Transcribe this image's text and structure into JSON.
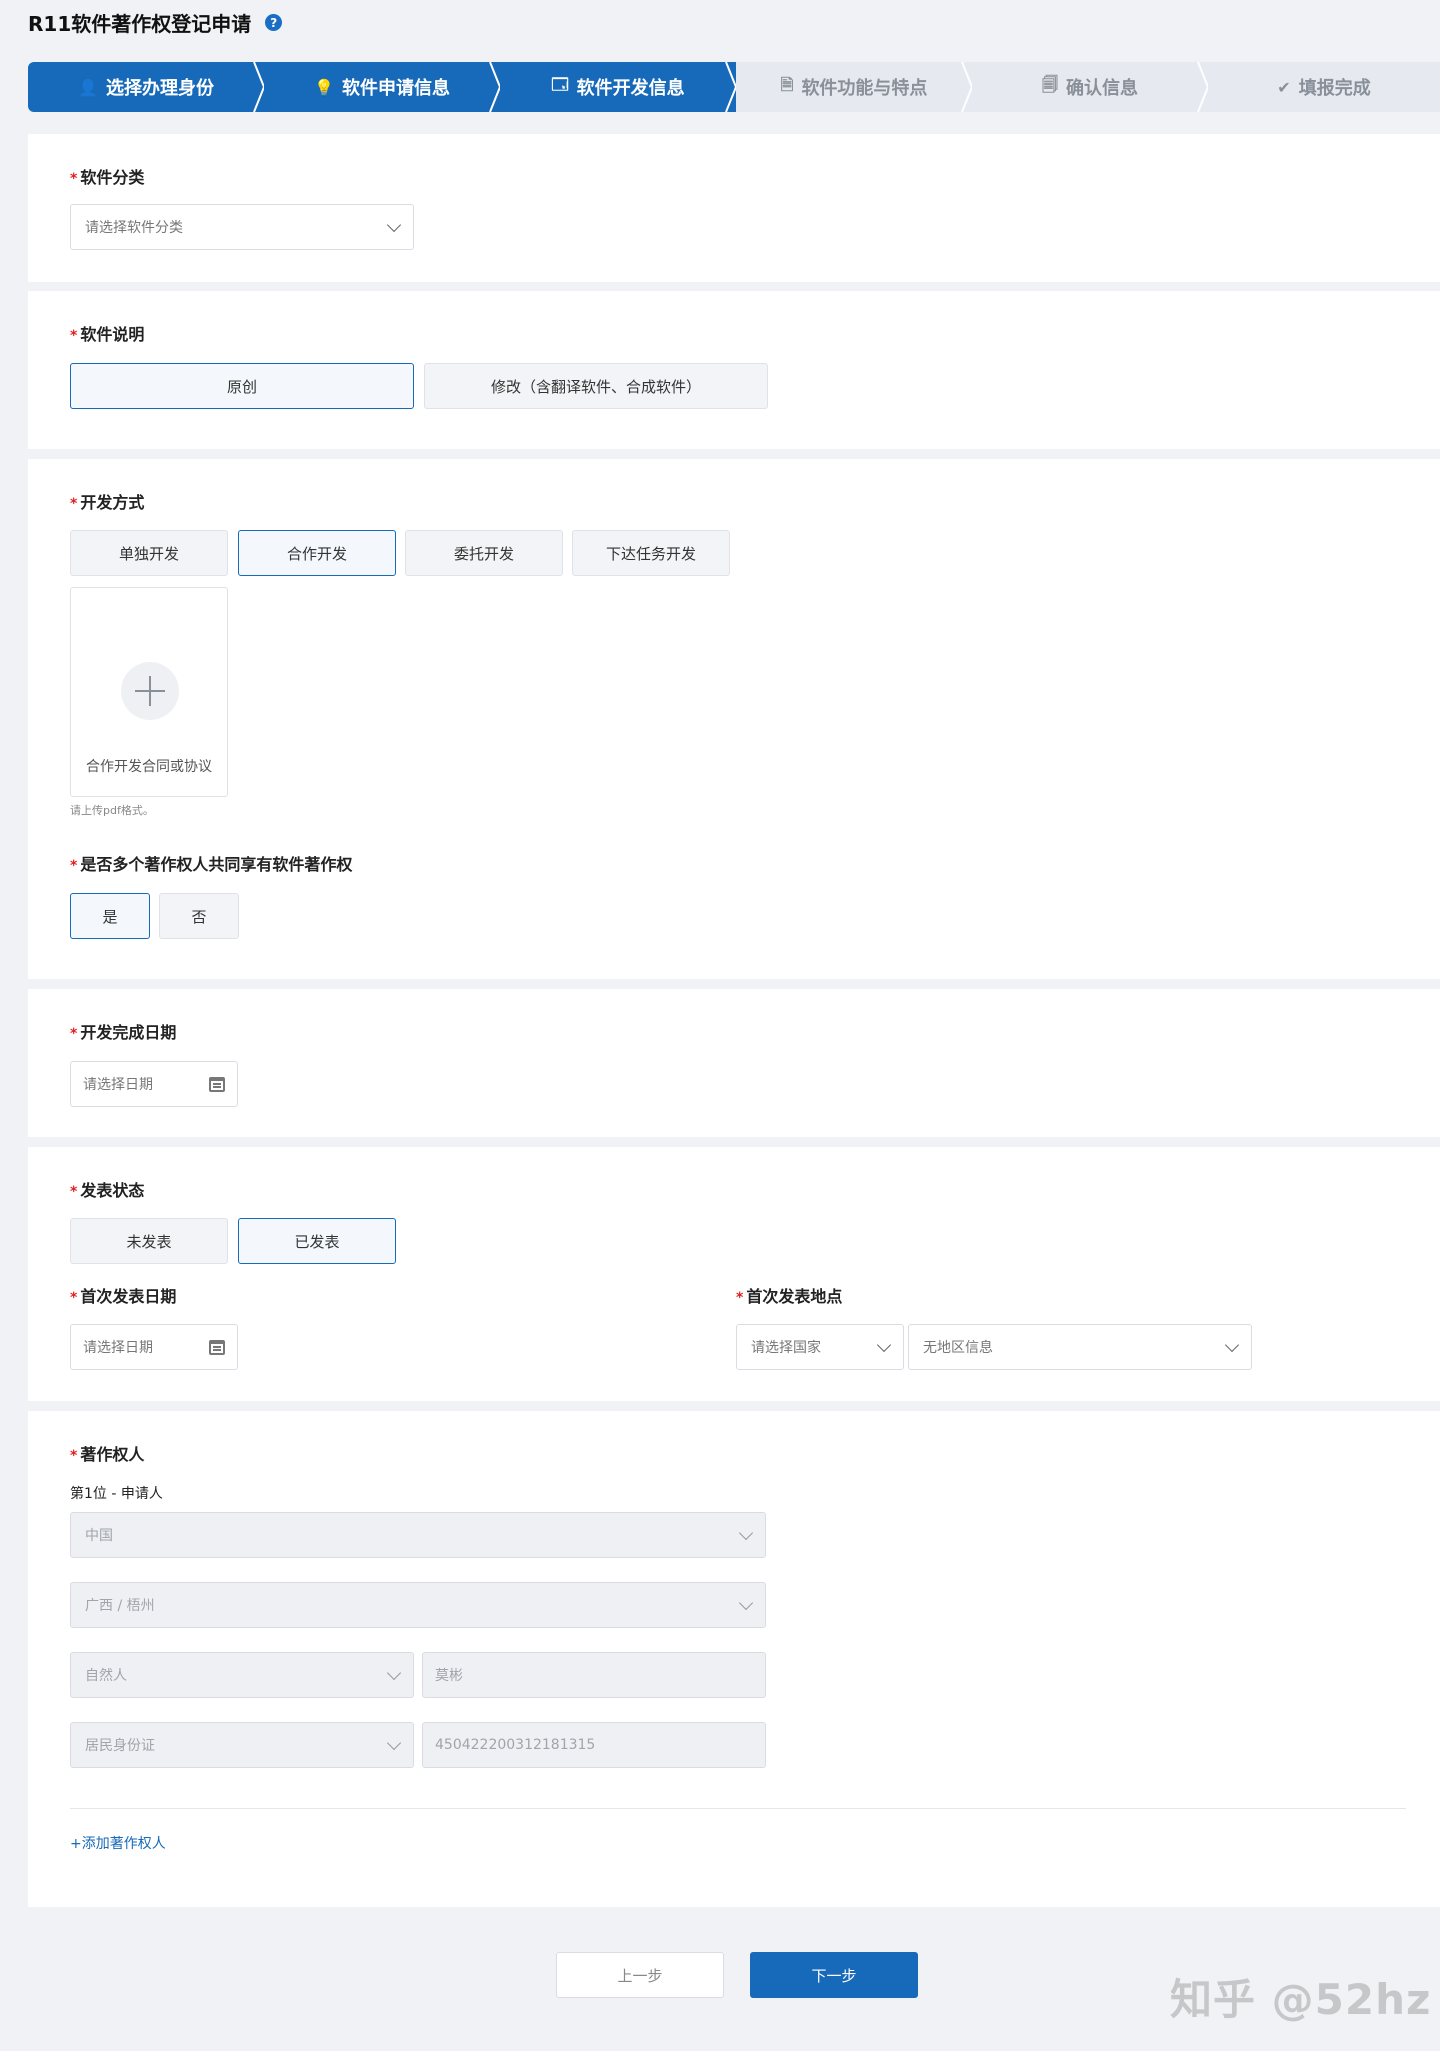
{
  "page": {
    "title": "R11软件著作权登记申请",
    "help_icon": "?"
  },
  "steps": [
    {
      "label": "选择办理身份",
      "icon": "user-icon",
      "glyph": "👤",
      "state": "active"
    },
    {
      "label": "软件申请信息",
      "icon": "lightbulb-icon",
      "glyph": "💡",
      "state": "active"
    },
    {
      "label": "软件开发信息",
      "icon": "code-window-icon",
      "glyph": "🗔",
      "state": "active"
    },
    {
      "label": "软件功能与特点",
      "icon": "document-icon",
      "glyph": "🗎",
      "state": "inactive"
    },
    {
      "label": "确认信息",
      "icon": "clipboard-icon",
      "glyph": "🗐",
      "state": "inactive"
    },
    {
      "label": "填报完成",
      "icon": "check-circle-icon",
      "glyph": "✔",
      "state": "inactive"
    }
  ],
  "category": {
    "label": "软件分类",
    "placeholder": "请选择软件分类"
  },
  "description": {
    "label": "软件说明",
    "options": [
      "原创",
      "修改（含翻译软件、合成软件）"
    ],
    "selected": "原创"
  },
  "dev_method": {
    "label": "开发方式",
    "options": [
      "单独开发",
      "合作开发",
      "委托开发",
      "下达任务开发"
    ],
    "selected": "合作开发",
    "upload_label": "合作开发合同或协议",
    "upload_hint": "请上传pdf格式。",
    "shared_label": "是否多个著作权人共同享有软件著作权",
    "shared_options": [
      "是",
      "否"
    ],
    "shared_selected": "是"
  },
  "completion_date": {
    "label": "开发完成日期",
    "placeholder": "请选择日期"
  },
  "publish": {
    "label": "发表状态",
    "options": [
      "未发表",
      "已发表"
    ],
    "selected": "已发表",
    "first_date_label": "首次发表日期",
    "first_date_placeholder": "请选择日期",
    "first_place_label": "首次发表地点",
    "country_placeholder": "请选择国家",
    "region_placeholder": "无地区信息"
  },
  "owners": {
    "label": "著作权人",
    "entry_title": "第1位 - 申请人",
    "country": "中国",
    "region": "广西 / 梧州",
    "type": "自然人",
    "name": "莫彬",
    "id_type": "居民身份证",
    "id_number": "450422200312181315",
    "add_link": "+添加著作权人"
  },
  "footer": {
    "prev_label": "上一步",
    "next_label": "下一步"
  },
  "watermark": "知乎 @52hz",
  "colors": {
    "accent": "#1769b9",
    "required": "#e02020",
    "step_inactive": "#e6eaf0"
  }
}
